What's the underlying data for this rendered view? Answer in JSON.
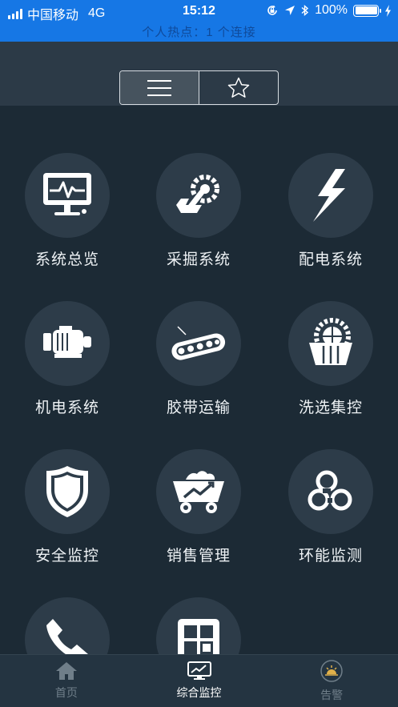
{
  "status": {
    "carrier": "中国移动",
    "network": "4G",
    "time": "15:12",
    "battery": "100%",
    "battery_level": 1.0,
    "hotspot_text": "个人热点：1 个连接"
  },
  "segment": {
    "options": [
      {
        "icon": "list-icon",
        "active": true
      },
      {
        "icon": "star-icon",
        "active": false
      }
    ]
  },
  "modules": [
    {
      "label": "系统总览",
      "icon": "monitor-icon"
    },
    {
      "label": "采掘系统",
      "icon": "excavator-icon"
    },
    {
      "label": "配电系统",
      "icon": "lightning-icon"
    },
    {
      "label": "机电系统",
      "icon": "motor-icon"
    },
    {
      "label": "胶带运输",
      "icon": "conveyor-belt-icon"
    },
    {
      "label": "洗选集控",
      "icon": "washing-wheel-icon"
    },
    {
      "label": "安全监控",
      "icon": "shield-icon"
    },
    {
      "label": "销售管理",
      "icon": "mine-cart-icon"
    },
    {
      "label": "环能监测",
      "icon": "environment-rings-icon"
    },
    {
      "label": "",
      "icon": "phone-icon"
    },
    {
      "label": "",
      "icon": "grid-icon"
    }
  ],
  "tabs": [
    {
      "label": "首页",
      "icon": "home-icon",
      "active": false
    },
    {
      "label": "综合监控",
      "icon": "monitor-chart-icon",
      "active": true
    },
    {
      "label": "告警",
      "icon": "alarm-sunrise-icon",
      "active": false
    }
  ],
  "colors": {
    "status_bar": "#1677e5",
    "header": "#2c3a47",
    "background": "#1c2a35",
    "icon_circle": "#2d3c49",
    "tabbar": "#243441"
  }
}
